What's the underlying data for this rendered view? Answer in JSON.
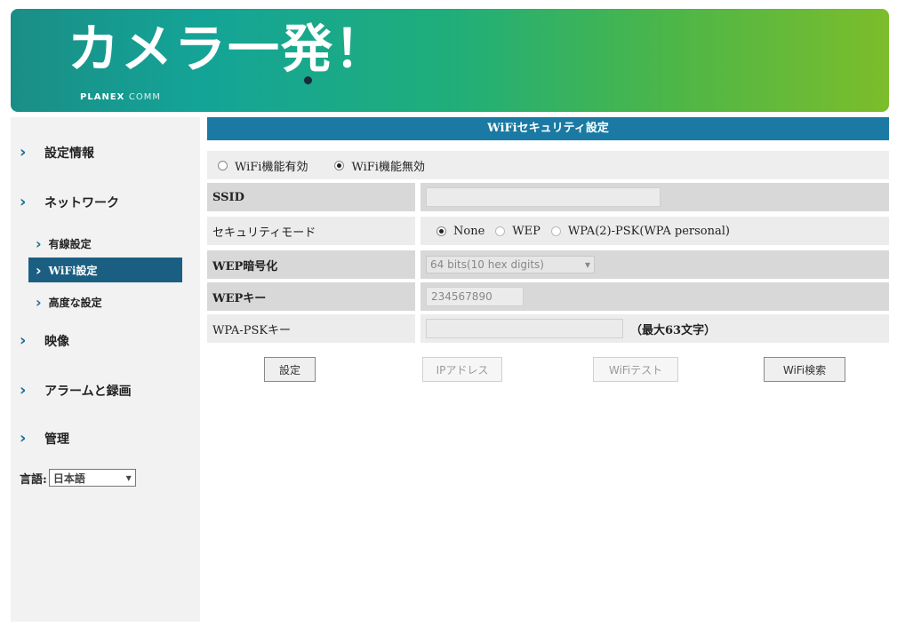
{
  "banner": {
    "title": "カメラ一発！",
    "brand": "PLANEX",
    "brand_sub": "COMM"
  },
  "sidebar": {
    "items": [
      {
        "label": "設定情報"
      },
      {
        "label": "ネットワーク"
      },
      {
        "label": "映像"
      },
      {
        "label": "アラームと録画"
      },
      {
        "label": "管理"
      }
    ],
    "network_sub": [
      {
        "label": "有線設定"
      },
      {
        "label": "WiFi設定"
      },
      {
        "label": "高度な設定"
      }
    ],
    "language_label": "言語:",
    "language_value": "日本語"
  },
  "main": {
    "title": "WiFiセキュリティ設定",
    "wifi_enable": "WiFi機能有効",
    "wifi_disable": "WiFi機能無効",
    "ssid_label": "SSID",
    "ssid_value": "",
    "security_mode_label": "セキュリティモード",
    "mode_none": "None",
    "mode_wep": "WEP",
    "mode_wpa": "WPA(2)-PSK(WPA personal)",
    "wep_enc_label": "WEP暗号化",
    "wep_enc_value": "64 bits(10 hex digits)",
    "wep_key_label": "WEPキー",
    "wep_key_value": "234567890",
    "wpa_key_label": "WPA-PSKキー",
    "wpa_key_value": "",
    "wpa_key_hint": "（最大63文字）"
  },
  "buttons": {
    "set": "設定",
    "ip_address": "IPアドレス",
    "wifi_test": "WiFiテスト",
    "wifi_search": "WiFi検索"
  }
}
